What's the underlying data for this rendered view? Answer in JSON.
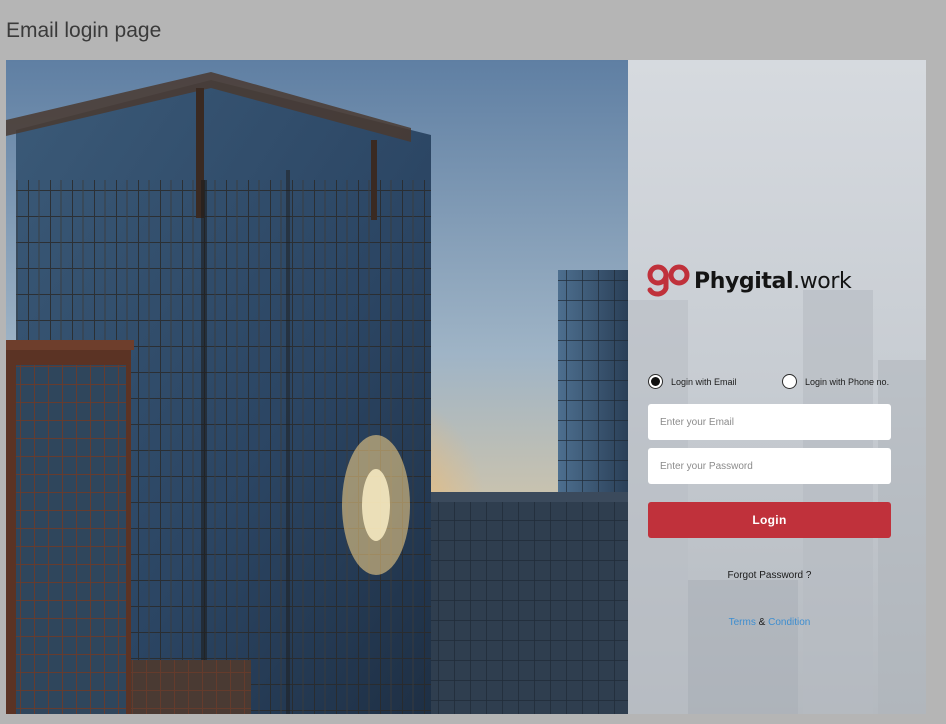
{
  "frame": {
    "title": "Email login page"
  },
  "brand": {
    "go": "go",
    "name_strong": "Phygital",
    "name_light": ".work",
    "accent_color": "#c0313b"
  },
  "login_mode": {
    "options": [
      {
        "label": "Login with Email",
        "selected": true
      },
      {
        "label": "Login with Phone no.",
        "selected": false
      }
    ]
  },
  "form": {
    "email_placeholder": "Enter your Email",
    "email_value": "",
    "password_placeholder": "Enter your Password",
    "password_value": "",
    "login_label": "Login",
    "forgot_label": "Forgot Password ?"
  },
  "footer": {
    "terms_label": "Terms",
    "separator": "&",
    "condition_label": "Condition"
  },
  "hero_image": {
    "description_icon": "city-buildings-photo"
  }
}
